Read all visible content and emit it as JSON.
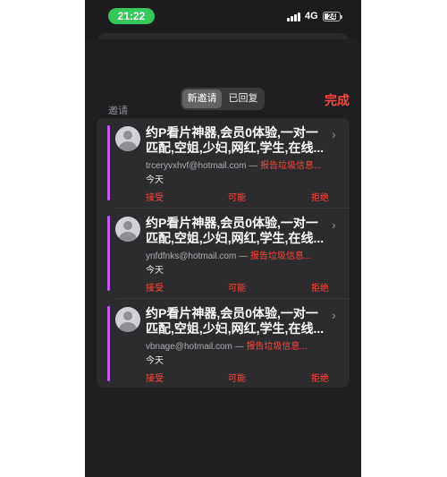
{
  "status": {
    "time": "21:22",
    "network": "4G",
    "battery": "24"
  },
  "header": {
    "tabs": [
      {
        "label": "新邀请"
      },
      {
        "label": "已回复"
      }
    ],
    "done_label": "完成"
  },
  "section": {
    "title": "邀请"
  },
  "invitations": [
    {
      "subject_line1": "约P看片神器,会员0体验,一对一",
      "subject_line2": "匹配,空姐,少妇,网红,学生,在线...",
      "sender": "trceryvxhvf@hotmail.com",
      "separator": " — ",
      "report": "报告垃圾信息...",
      "date": "今天",
      "accept": "接受",
      "maybe": "可能",
      "decline": "拒绝"
    },
    {
      "subject_line1": "约P看片神器,会员0体验,一对一",
      "subject_line2": "匹配,空姐,少妇,网红,学生,在线...",
      "sender": "ynfdfnks@hotmail.com",
      "separator": " — ",
      "report": "报告垃圾信息...",
      "date": "今天",
      "accept": "接受",
      "maybe": "可能",
      "decline": "拒绝"
    },
    {
      "subject_line1": "约P看片神器,会员0体验,一对一",
      "subject_line2": "匹配,空姐,少妇,网红,学生,在线...",
      "sender": "vbnage@hotmail.com",
      "separator": " — ",
      "report": "报告垃圾信息...",
      "date": "今天",
      "accept": "接受",
      "maybe": "可能",
      "decline": "拒绝"
    }
  ],
  "colors": {
    "accent_red": "#ff453a",
    "calendar_bar": "#bf5af2",
    "status_pill": "#34c759"
  }
}
